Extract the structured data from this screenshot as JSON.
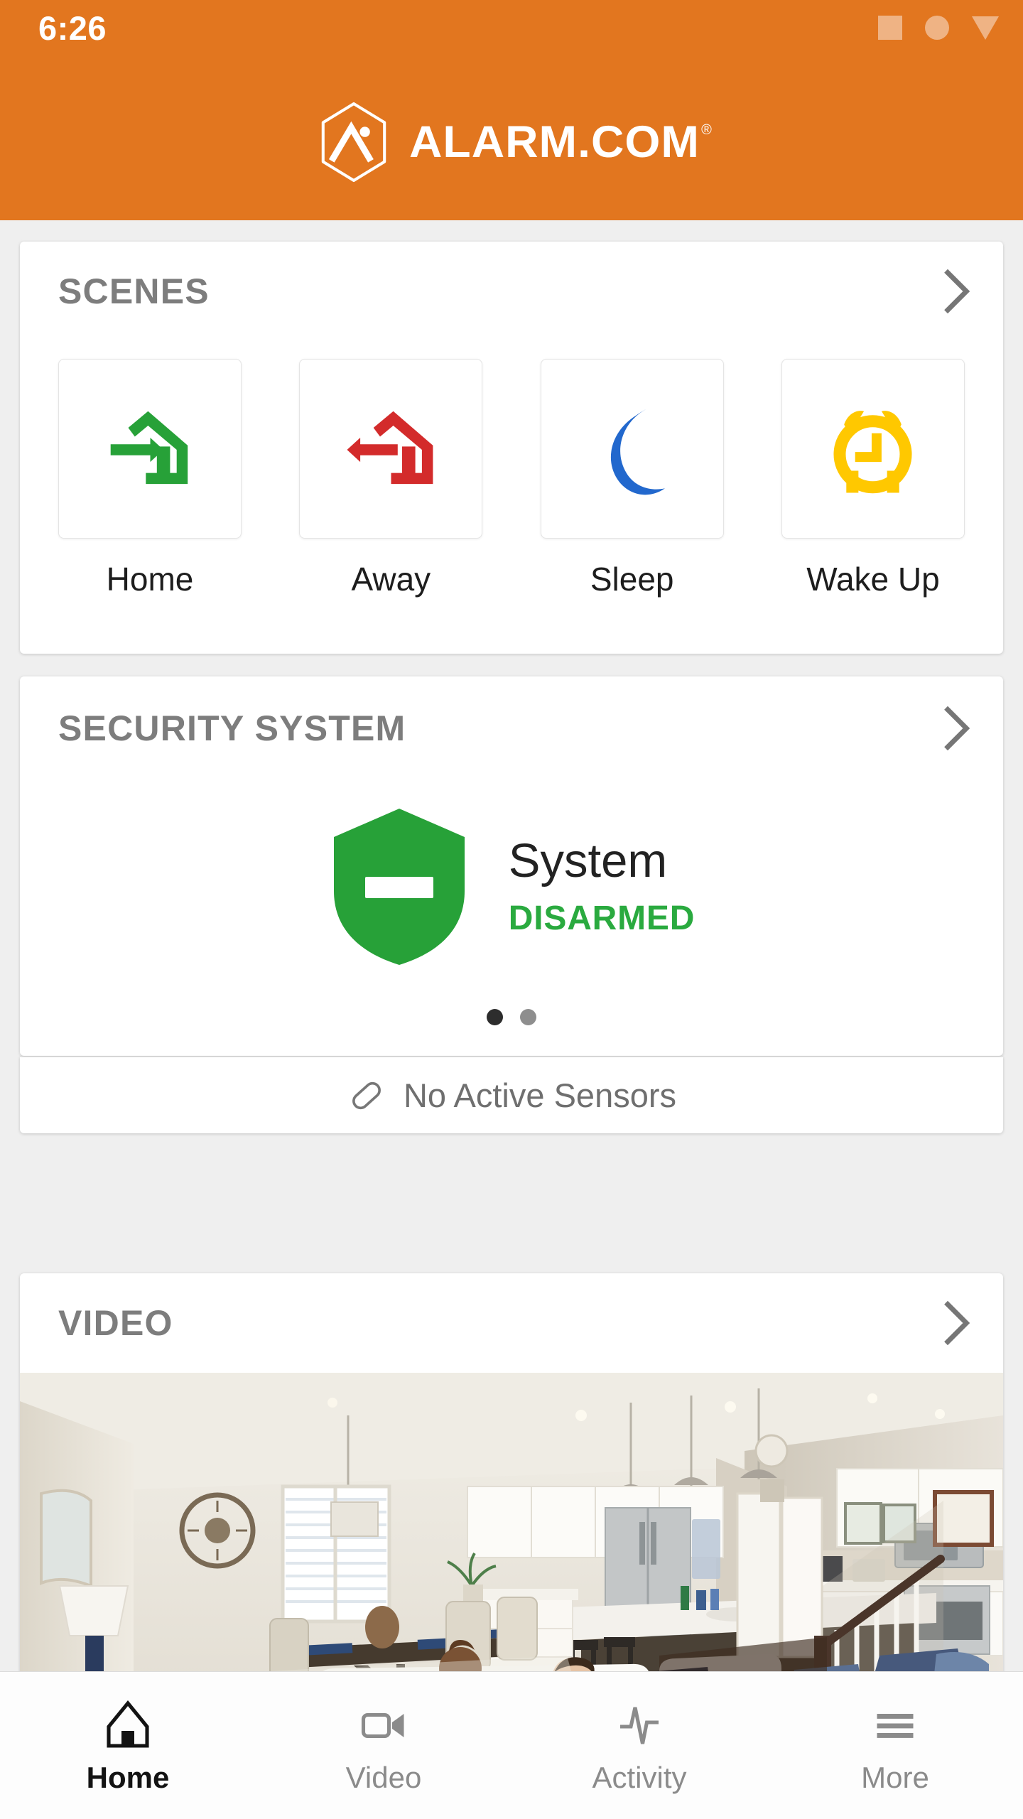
{
  "status_bar": {
    "time": "6:26",
    "icons": [
      "square-placeholder-icon",
      "circle-placeholder-icon",
      "triangle-down-placeholder-icon"
    ]
  },
  "header": {
    "brand_name": "ALARM.COM",
    "brand_registered": "®",
    "logo_icon": "alarm-dot-com-hexagon-logo",
    "background_color": "#e2761f"
  },
  "scenes": {
    "title": "SCENES",
    "chevron": "chevron-right-icon",
    "items": [
      {
        "label": "Home",
        "icon": "arrow-into-house-icon",
        "color": "#27a138"
      },
      {
        "label": "Away",
        "icon": "arrow-out-of-house-icon",
        "color": "#d32b2b"
      },
      {
        "label": "Sleep",
        "icon": "crescent-moon-icon",
        "color": "#2268cd"
      },
      {
        "label": "Wake Up",
        "icon": "alarm-clock-icon",
        "color": "#ffc800"
      }
    ]
  },
  "security": {
    "title": "SECURITY SYSTEM",
    "chevron": "chevron-right-icon",
    "panel_name": "System",
    "state": "DISARMED",
    "state_color": "#2aaa3f",
    "shield_icon": "green-shield-disarmed-icon",
    "pager": {
      "count": 2,
      "active_index": 0
    },
    "sensors_row": {
      "icon": "contact-sensor-icon",
      "text": "No Active Sensors"
    }
  },
  "video": {
    "title": "VIDEO",
    "chevron": "chevron-right-icon",
    "thumbnail_alt": "Live camera view of open-plan kitchen and living room with two children on a sofa"
  },
  "bottom_nav": {
    "items": [
      {
        "label": "Home",
        "icon": "house-icon",
        "active": true
      },
      {
        "label": "Video",
        "icon": "video-camera-icon",
        "active": false
      },
      {
        "label": "Activity",
        "icon": "pulse-wave-icon",
        "active": false
      },
      {
        "label": "More",
        "icon": "hamburger-menu-icon",
        "active": false
      }
    ]
  }
}
